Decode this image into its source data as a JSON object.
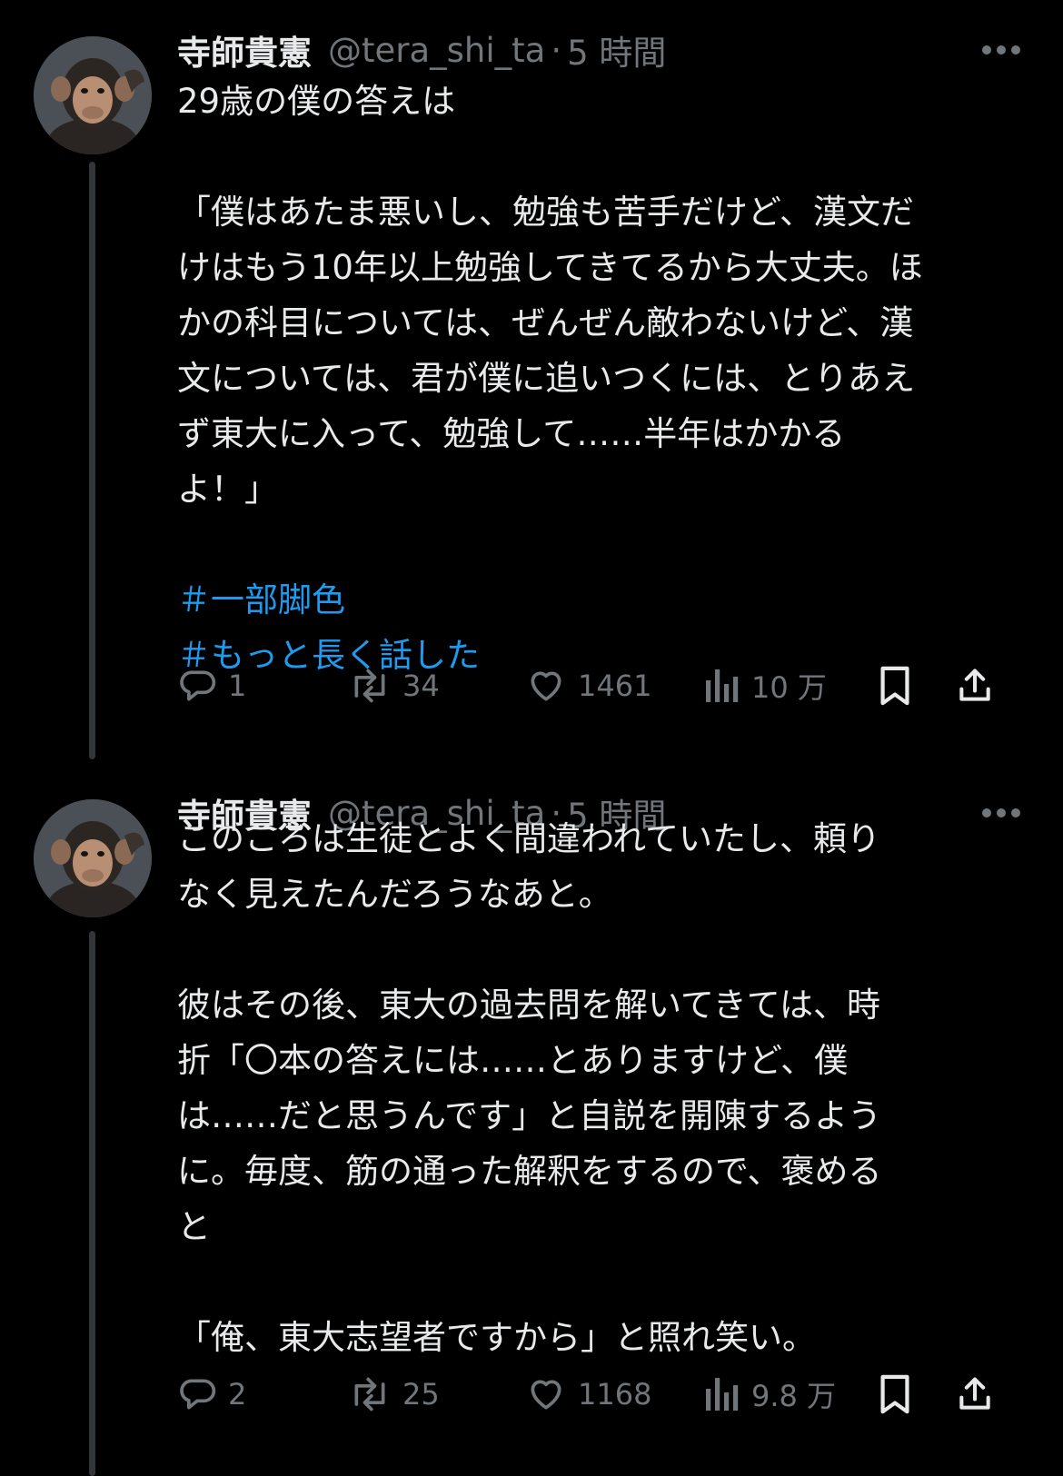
{
  "tweets": [
    {
      "display_name": "寺師貴憲",
      "handle": "@tera_shi_ta",
      "separator": "·",
      "time": "5 時間",
      "lines": [
        "29歳の僕の答えは",
        "",
        "「僕はあたま悪いし、勉強も苦手だけど、漢文だ",
        "けはもう10年以上勉強してきてるから大丈夫。ほ",
        "かの科目については、ぜんぜん敵わないけど、漢",
        "文については、君が僕に追いつくには、とりあえ",
        "ず東大に入って、勉強して……半年はかかる",
        "よ！」",
        ""
      ],
      "hashtags": [
        "＃一部脚色",
        "＃もっと長く話した"
      ],
      "stats": {
        "replies": "1",
        "retweets": "34",
        "likes": "1461",
        "views": "10 万"
      }
    },
    {
      "display_name": "寺師貴憲",
      "handle": "@tera_shi_ta",
      "separator": "·",
      "time": "5 時間",
      "lines": [
        "このころは生徒とよく間違われていたし、頼り",
        "なく見えたんだろうなあと。",
        "",
        "彼はその後、東大の過去問を解いてきては、時",
        "折「〇本の答えには……とありますけど、僕",
        "は……だと思うんです」と自説を開陳するよう",
        "に。毎度、筋の通った解釈をするので、褒める",
        "と",
        "",
        "「俺、東大志望者ですから」と照れ笑い。"
      ],
      "hashtags": [],
      "stats": {
        "replies": "2",
        "retweets": "25",
        "likes": "1168",
        "views": "9.8 万"
      }
    }
  ],
  "icons": {
    "more": "more-horizontal-icon",
    "reply": "reply-bubble-icon",
    "retweet": "retweet-icon",
    "like": "heart-icon",
    "views": "views-bar-chart-icon",
    "bookmark": "bookmark-icon",
    "share": "share-upload-icon"
  },
  "colors": {
    "background": "#000000",
    "text": "#e7e9ea",
    "muted": "#71767b",
    "link": "#1d9bf0",
    "thread_line": "#333639"
  }
}
